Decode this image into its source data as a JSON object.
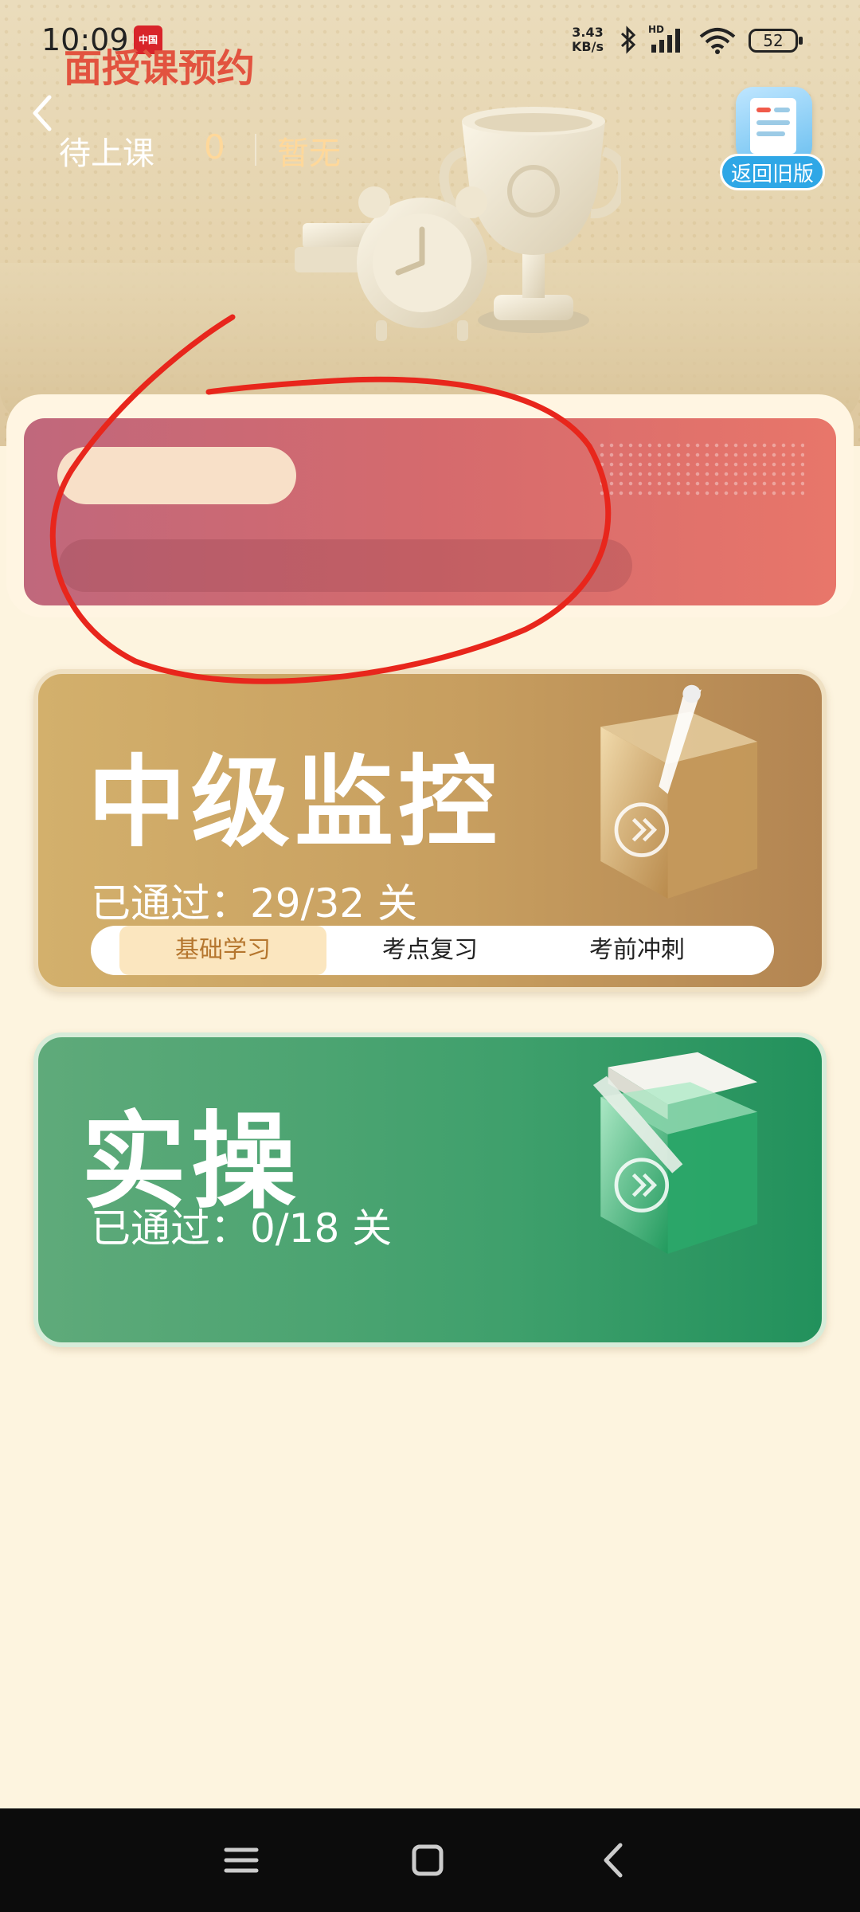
{
  "status_bar": {
    "time": "10:09",
    "app_badge": "中国",
    "net_speed_value": "3.43",
    "net_speed_unit": "KB/s",
    "signal_label": "HD",
    "battery_level": "52"
  },
  "header": {
    "old_version_label": "返回旧版"
  },
  "booking": {
    "title": "面授课预约",
    "pending_label": "待上课",
    "pending_count": "0",
    "pending_status": "暂无"
  },
  "courses": [
    {
      "title": "中级监控",
      "progress": "已通过：29/32 关",
      "passed": 29,
      "total": 32,
      "tabs": [
        "基础学习",
        "考点复习",
        "考前冲刺"
      ],
      "active_tab": 0
    },
    {
      "title": "实操",
      "progress": "已通过：0/18 关",
      "passed": 0,
      "total": 18
    }
  ],
  "colors": {
    "background": "#fdf4df",
    "booking_gradient_start": "#c0687c",
    "booking_gradient_end": "#e8766a",
    "intermediate_card": "#c79e5f",
    "practical_card": "#3fa06c",
    "annotation": "#e8261c"
  },
  "icons": {
    "back": "chevron-left-icon",
    "old_version": "document-icon",
    "nav_menu": "menu-icon",
    "nav_home": "square-icon",
    "nav_back": "triangle-back-icon"
  }
}
